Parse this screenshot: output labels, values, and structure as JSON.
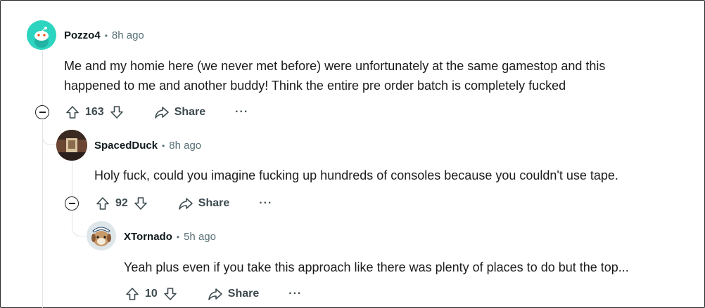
{
  "comments": [
    {
      "author": "Pozzo4",
      "time": "8h ago",
      "body_lines": [
        "Me and my homie here (we never met before) were unfortunately at the same gamestop and this",
        "happened to me and another buddy! Think the entire pre order batch is completely fucked"
      ],
      "score": "163",
      "share_label": "Share",
      "more_label": "···",
      "avatar_color": "#2dd4bf"
    },
    {
      "author": "SpacedDuck",
      "time": "8h ago",
      "body_lines": [
        "Holy fuck, could you imagine fucking up hundreds of consoles because you couldn't use tape."
      ],
      "score": "92",
      "share_label": "Share",
      "more_label": "···"
    },
    {
      "author": "XTornado",
      "time": "5h ago",
      "body_lines": [
        "Yeah plus even if you take this approach like there was plenty of places to do but the top..."
      ],
      "score": "10",
      "share_label": "Share",
      "more_label": "···"
    }
  ],
  "separator": "•",
  "icons": {
    "upvote": "upvote-icon",
    "downvote": "downvote-icon",
    "share": "share-icon",
    "collapse": "collapse-icon"
  }
}
